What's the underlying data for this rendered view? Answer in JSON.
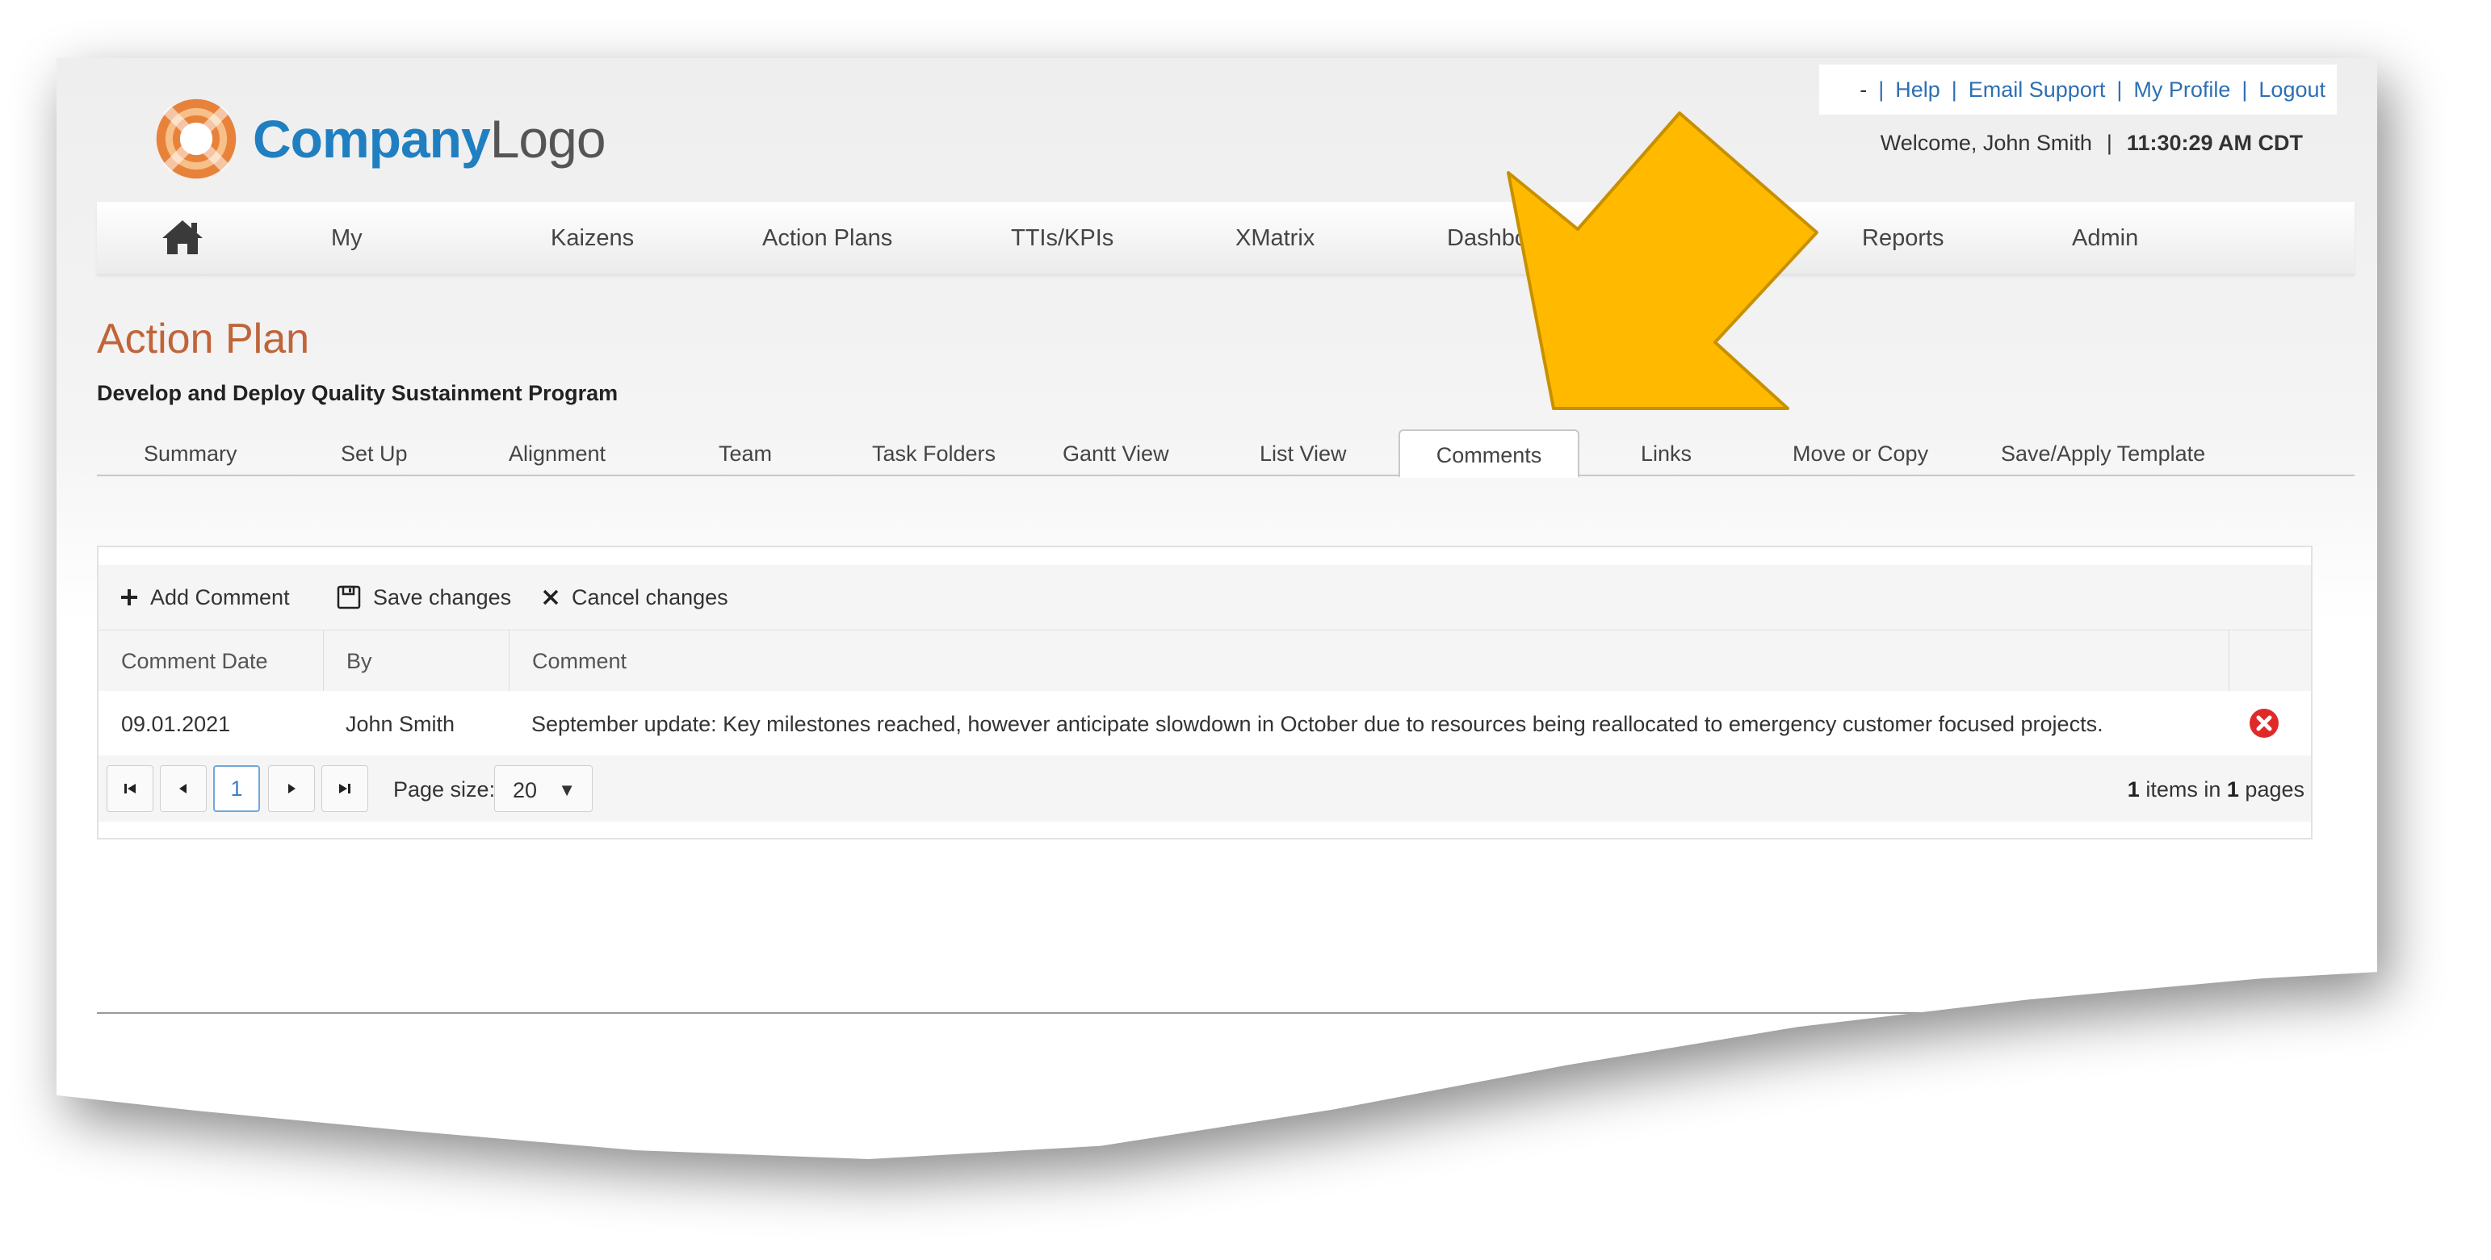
{
  "header": {
    "logo": {
      "part1": "Company",
      "part2": "Logo"
    },
    "util_links": {
      "dash": "-",
      "help": "Help",
      "email_support": "Email Support",
      "my_profile": "My Profile",
      "logout": "Logout",
      "separator": "|"
    },
    "welcome": "Welcome, John Smith",
    "welcome_sep": "|",
    "time": "11:30:29 AM CDT"
  },
  "nav": {
    "items": [
      "My",
      "Kaizens",
      "Action Plans",
      "TTIs/KPIs",
      "XMatrix",
      "Dashboard",
      "Reports",
      "Admin"
    ]
  },
  "page": {
    "title": "Action Plan",
    "subtitle": "Develop and Deploy Quality Sustainment Program"
  },
  "tabs": [
    "Summary",
    "Set Up",
    "Alignment",
    "Team",
    "Task Folders",
    "Gantt View",
    "List View",
    "Comments",
    "Links",
    "Move or Copy",
    "Save/Apply Template"
  ],
  "active_tab": "Comments",
  "toolbar": {
    "add_comment": "Add Comment",
    "save_changes": "Save changes",
    "cancel_changes": "Cancel changes"
  },
  "grid": {
    "columns": [
      "Comment Date",
      "By",
      "Comment"
    ],
    "rows": [
      {
        "date": "09.01.2021",
        "by": "John Smith",
        "comment": "September update: Key milestones reached, however anticipate slowdown in October due to resources being reallocated to emergency customer focused projects."
      }
    ]
  },
  "pager": {
    "current_page": "1",
    "page_size_label": "Page size:",
    "page_size": "20",
    "items_count": "1",
    "items_text": "items in",
    "pages_count": "1",
    "pages_text": "pages"
  },
  "colors": {
    "accent_title": "#c0643a",
    "link": "#2e6fb3",
    "callout_arrow": "#ffba00",
    "delete_icon": "#e02a2a"
  }
}
